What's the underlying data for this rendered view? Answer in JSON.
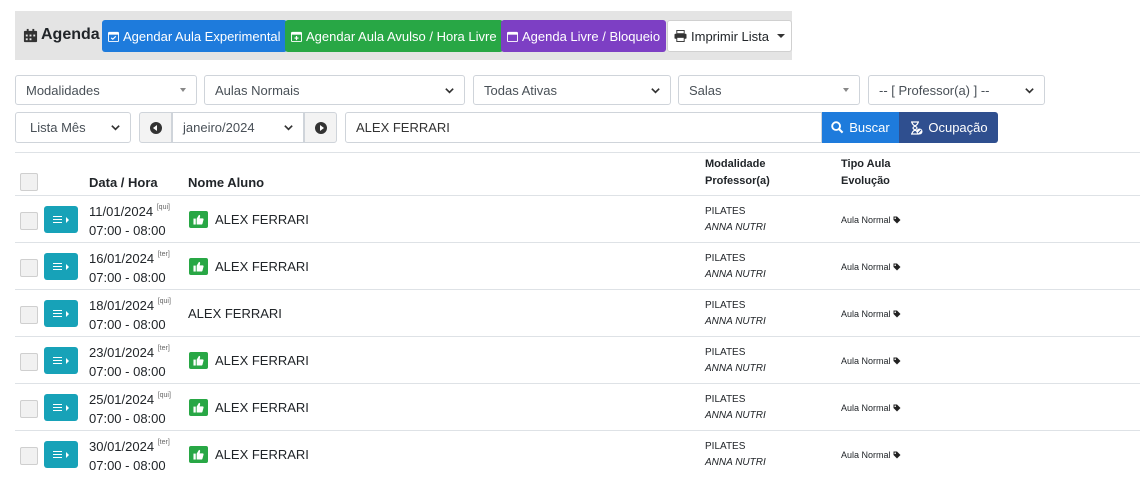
{
  "toolbar": {
    "title": "Agenda",
    "btn_experimental": "Agendar Aula Experimental",
    "btn_avulso": "Agendar Aula Avulso / Hora Livre",
    "btn_livre": "Agenda Livre / Bloqueio",
    "btn_imprimir": "Imprimir Lista"
  },
  "filters": {
    "modalidades": "Modalidades",
    "aulas": "Aulas Normais",
    "status": "Todas Ativas",
    "salas": "Salas",
    "professor": "-- [ Professor(a) ] --",
    "view": "Lista Mês",
    "month": "janeiro/2024"
  },
  "search": {
    "value": "ALEX FERRARI",
    "buscar": "Buscar",
    "ocupacao": "Ocupação"
  },
  "table": {
    "col_data": "Data / Hora",
    "col_nome": "Nome Aluno",
    "col_modalidade": "Modalidade",
    "col_professor": "Professor(a)",
    "col_tipo": "Tipo Aula",
    "col_evolucao": "Evolução",
    "rows": [
      {
        "date": "11/01/2024",
        "weekday": "[qui]",
        "time": "07:00 - 08:00",
        "name": "ALEX FERRARI",
        "modalidade": "PILATES",
        "professor": "ANNA NUTRI",
        "tipo": "Aula Normal"
      },
      {
        "date": "16/01/2024",
        "weekday": "[ter]",
        "time": "07:00 - 08:00",
        "name": "ALEX FERRARI",
        "modalidade": "PILATES",
        "professor": "ANNA NUTRI",
        "tipo": "Aula Normal"
      },
      {
        "date": "18/01/2024",
        "weekday": "[qui]",
        "time": "07:00 - 08:00",
        "name": "ALEX FERRARI",
        "modalidade": "PILATES",
        "professor": "ANNA NUTRI",
        "tipo": "Aula Normal"
      },
      {
        "date": "23/01/2024",
        "weekday": "[ter]",
        "time": "07:00 - 08:00",
        "name": "ALEX FERRARI",
        "modalidade": "PILATES",
        "professor": "ANNA NUTRI",
        "tipo": "Aula Normal"
      },
      {
        "date": "25/01/2024",
        "weekday": "[qui]",
        "time": "07:00 - 08:00",
        "name": "ALEX FERRARI",
        "modalidade": "PILATES",
        "professor": "ANNA NUTRI",
        "tipo": "Aula Normal"
      },
      {
        "date": "30/01/2024",
        "weekday": "[ter]",
        "time": "07:00 - 08:00",
        "name": "ALEX FERRARI",
        "modalidade": "PILATES",
        "professor": "ANNA NUTRI",
        "tipo": "Aula Normal"
      }
    ]
  },
  "icons": {
    "calendar": "calendar-icon",
    "calendar_check": "calendar-check-icon",
    "calendar_plus": "calendar-plus-icon",
    "printer": "printer-icon",
    "search": "search-icon",
    "hourglass": "hourglass-icon",
    "thumbs_up": "thumbs-up-icon",
    "tag": "tag-icon"
  },
  "colors": {
    "primary": "#1e7bdc",
    "success": "#28a745",
    "purple": "#7d3fc4",
    "info": "#17a2b8",
    "navy": "#2f4f8f"
  }
}
